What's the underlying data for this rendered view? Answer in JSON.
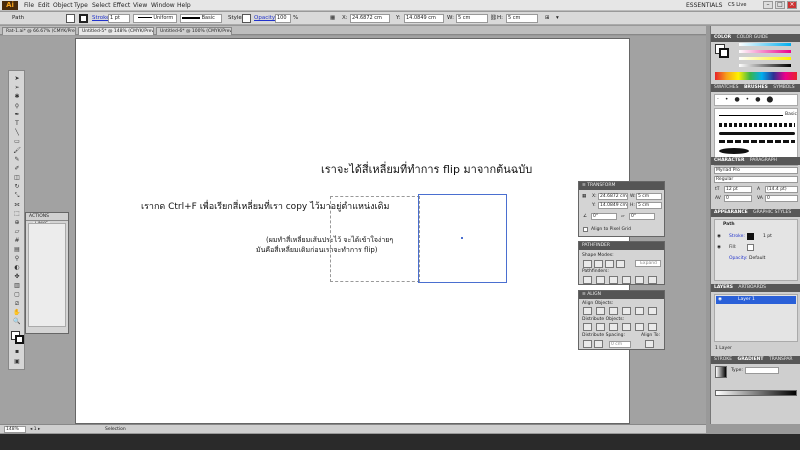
{
  "app": {
    "logo": "Ai",
    "workspace": "ESSENTIALS",
    "cslive": "CS Live"
  },
  "menu": [
    "File",
    "Edit",
    "Object",
    "Type",
    "Select",
    "Effect",
    "View",
    "Window",
    "Help"
  ],
  "control": {
    "object_type": "Path",
    "stroke_label": "Stroke:",
    "stroke_value": "1 pt",
    "profile": "Uniform",
    "brush": "Basic",
    "style_label": "Style:",
    "opacity_label": "Opacity:",
    "opacity_value": "100",
    "opacity_unit": "%",
    "x_label": "X:",
    "x_value": "24.6872 cm",
    "y_label": "Y:",
    "y_value": "14.0849 cm",
    "w_label": "W:",
    "w_value": "5 cm",
    "h_label": "H:",
    "h_value": "5 cm"
  },
  "tabs": [
    {
      "label": "Rat-1.ai* @ 66.67% (CMYK/Preview)",
      "active": false
    },
    {
      "label": "Untitled-5* @ 148% (CMYK/Preview)",
      "active": true
    },
    {
      "label": "Untitled-6* @ 100% (CMYK/Preview)",
      "active": false
    }
  ],
  "canvas": {
    "text_main": "เราจะได้สี่เหลี่ยมที่ทำการ flip มาจากต้นฉบับ",
    "text_ctrl": "เรากด Ctrl+F เพื่อเรียกสี่เหลี่ยมที่เรา copy ไว้มาอยู่ตำแหน่งเดิม",
    "note_line1": "(ผมทำสี่เหลี่ยมเส้นประไว้ จะได้เข้าใจง่ายๆ",
    "note_line2": "มันคือสี่เหลี่ยมเดิมก่อนเราจะทำการ flip)"
  },
  "actions_panel": {
    "tabs": [
      "ACTIONS",
      "LINKS"
    ]
  },
  "transform_panel": {
    "title": "TRANSFORM",
    "x": "24.6872 cm",
    "y": "14.0849 cm",
    "w": "5 cm",
    "h": "5 cm",
    "angle": "0°",
    "shear": "0°",
    "align_pixel": "Align to Pixel Grid"
  },
  "pathfinder_panel": {
    "title": "PATHFINDER",
    "shape_modes": "Shape Modes:",
    "expand": "Expand",
    "pathfinders": "Pathfinders:"
  },
  "align_panel": {
    "title": "ALIGN",
    "align_objects": "Align Objects:",
    "distribute_objects": "Distribute Objects:",
    "distribute_spacing": "Distribute Spacing:",
    "align_to": "Align To:",
    "spacing_value": "0 cm"
  },
  "dock": {
    "color_tabs": [
      "COLOR",
      "COLOR GUIDE"
    ],
    "swatch_tabs": [
      "SWATCHES",
      "BRUSHES",
      "SYMBOLS"
    ],
    "brush_basic": "Basic",
    "char_tabs": [
      "CHARACTER",
      "PARAGRAPH",
      "OPENTYPE"
    ],
    "font_name": "Myriad Pro",
    "font_style": "Regular",
    "font_size": "12 pt",
    "leading": "(14.4 pt)",
    "tracking_a": "0",
    "tracking_b": "0",
    "appearance_tabs": [
      "APPEARANCE",
      "GRAPHIC STYLES"
    ],
    "appearance_path": "Path",
    "appearance_stroke": "Stroke:",
    "appearance_stroke_value": "1 pt",
    "appearance_fill": "Fill:",
    "appearance_opacity": "Opacity:",
    "appearance_opacity_value": "Default",
    "layers_tabs": [
      "LAYERS",
      "ARTBOARDS"
    ],
    "layer_name": "Layer 1",
    "layer_count": "1 Layer",
    "gradient_tabs": [
      "STROKE",
      "GRADIENT",
      "TRANSPAR"
    ],
    "gradient_type": "Type:"
  },
  "status": {
    "zoom": "148%",
    "tool": "Selection"
  },
  "colors": {
    "selection": "#4a6fd0",
    "accent": "#f7a21b",
    "layer": "#2a60d8"
  }
}
